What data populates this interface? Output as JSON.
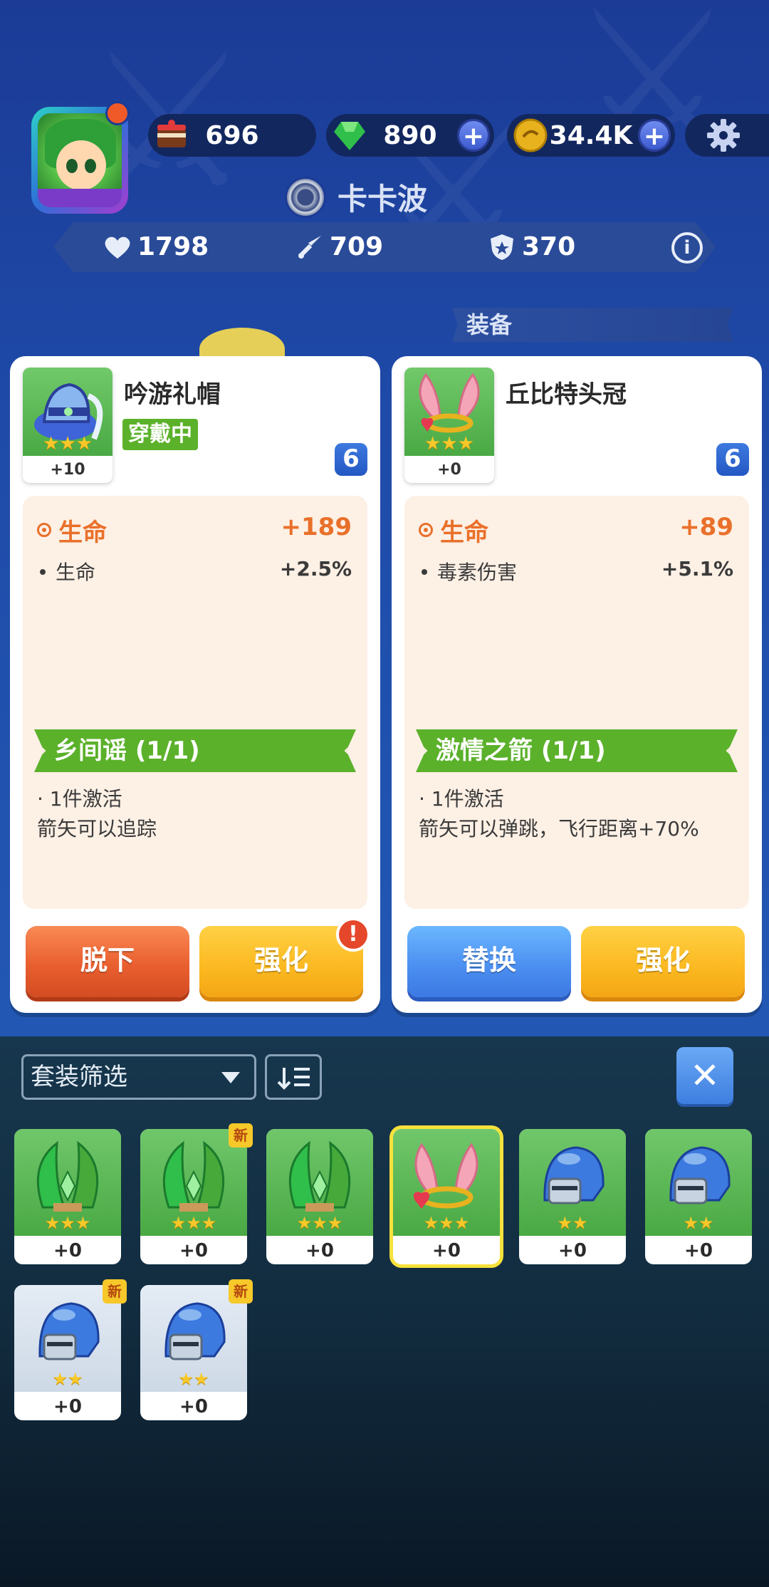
{
  "resources": {
    "cake": "696",
    "gems": "890",
    "coins": "34.4K"
  },
  "player": {
    "name": "卡卡波"
  },
  "stats": {
    "hp": "1798",
    "attack": "709",
    "defense": "370"
  },
  "section_title": "装备",
  "equipped": {
    "item_name": "吟游礼帽",
    "level": "+10",
    "stars": "★★★",
    "status": "穿戴中",
    "lock": "6",
    "main_stat_label": "生命",
    "main_stat_value": "+189",
    "sub_stat_label": "生命",
    "sub_stat_value": "+2.5%",
    "set_name": "乡间谣 (1/1)",
    "set_activate": "· 1件激活",
    "set_desc": "箭矢可以追踪",
    "btn_left": "脱下",
    "btn_right": "强化",
    "alert": "!"
  },
  "compare": {
    "item_name": "丘比特头冠",
    "level": "+0",
    "stars": "★★★",
    "lock": "6",
    "main_stat_label": "生命",
    "main_stat_value": "+89",
    "sub_stat_label": "毒素伤害",
    "sub_stat_value": "+5.1%",
    "set_name": "激情之箭 (1/1)",
    "set_activate": "· 1件激活",
    "set_desc": "箭矢可以弹跳，飞行距离+70%",
    "btn_left": "替换",
    "btn_right": "强化"
  },
  "filter": {
    "label": "套装筛选",
    "close": "✕"
  },
  "inventory": [
    {
      "level": "+0",
      "stars": "★★★",
      "art": "green-leaf",
      "new": ""
    },
    {
      "level": "+0",
      "stars": "★★★",
      "art": "green-leaf",
      "new": "新"
    },
    {
      "level": "+0",
      "stars": "★★★",
      "art": "green-leaf",
      "new": ""
    },
    {
      "level": "+0",
      "stars": "★★★",
      "art": "pink-wings",
      "new": ""
    },
    {
      "level": "+0",
      "stars": "★★",
      "art": "blue-helmet",
      "new": ""
    },
    {
      "level": "+0",
      "stars": "★★",
      "art": "blue-helmet",
      "new": ""
    },
    {
      "level": "+0",
      "stars": "★★",
      "art": "blue-helmet-grey",
      "new": "新"
    },
    {
      "level": "+0",
      "stars": "★★",
      "art": "blue-helmet-grey",
      "new": "新"
    }
  ]
}
